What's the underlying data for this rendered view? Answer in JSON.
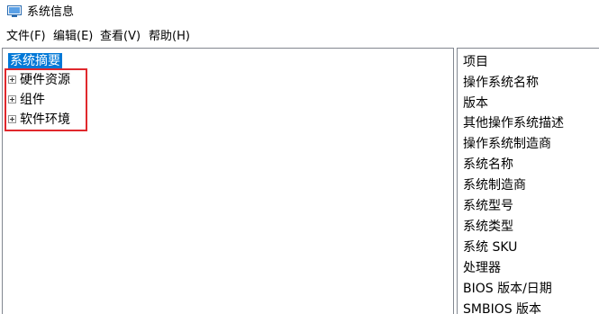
{
  "window": {
    "title": "系统信息",
    "icon": "system-info-icon"
  },
  "menu": [
    {
      "label": "文件(F)"
    },
    {
      "label": "编辑(E)"
    },
    {
      "label": "查看(V)"
    },
    {
      "label": "帮助(H)"
    }
  ],
  "tree": {
    "root_label": "系统摘要",
    "children": [
      {
        "label": "硬件资源"
      },
      {
        "label": "组件"
      },
      {
        "label": "软件环境"
      }
    ]
  },
  "details": {
    "column_header": "项目",
    "items": [
      "操作系统名称",
      "版本",
      "其他操作系统描述",
      "操作系统制造商",
      "系统名称",
      "系统制造商",
      "系统型号",
      "系统类型",
      "系统 SKU",
      "处理器",
      "BIOS 版本/日期",
      "SMBIOS 版本"
    ]
  },
  "colors": {
    "selection": "#0078d7",
    "annotation_border": "#e0282d"
  }
}
